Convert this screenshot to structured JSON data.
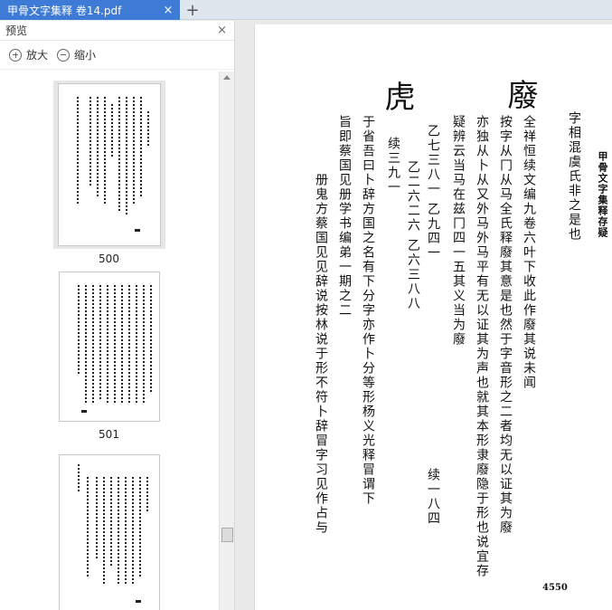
{
  "tab": {
    "title": "甲骨文字集释 卷14.pdf"
  },
  "tab_add_symbol": "+",
  "tab_close_symbol": "×",
  "panel": {
    "title": "预览",
    "close_symbol": "×",
    "zoom_in_label": "放大",
    "zoom_out_label": "缩小"
  },
  "thumbnails": [
    {
      "label": "500",
      "selected": true
    },
    {
      "label": "501",
      "selected": false
    },
    {
      "label": "",
      "selected": false
    }
  ],
  "document": {
    "header": "甲骨文字集释存疑",
    "page_number": "4550",
    "columns": [
      "字相混虞氏非之是也",
      "全祥恒续文编九卷六叶下收此作廢其说未闻",
      "按字从冂从马全氏释廢其意是也然于字音形之二者均无以证其为廢",
      "亦独从卜从又外马外马平有无以证其为声也就其本形隶廢隐于形也说宜存",
      "疑辨云当马在兹冂四一五其义当为廢",
      "续三九一",
      "于省吾曰卜辞方国之名有下分字亦作卜分等形杨义光释冒谓下",
      "旨即蔡国见册学书编弟一期之二",
      "册鬼方蔡国见见辞说按林说于形不符卜辞冒字习见作占与"
    ],
    "big_chars": [
      "廢",
      "虎"
    ],
    "numerals": [
      "乙七三八一 乙九四一",
      "乙二六二六 乙六三八八",
      "续一八四"
    ]
  }
}
